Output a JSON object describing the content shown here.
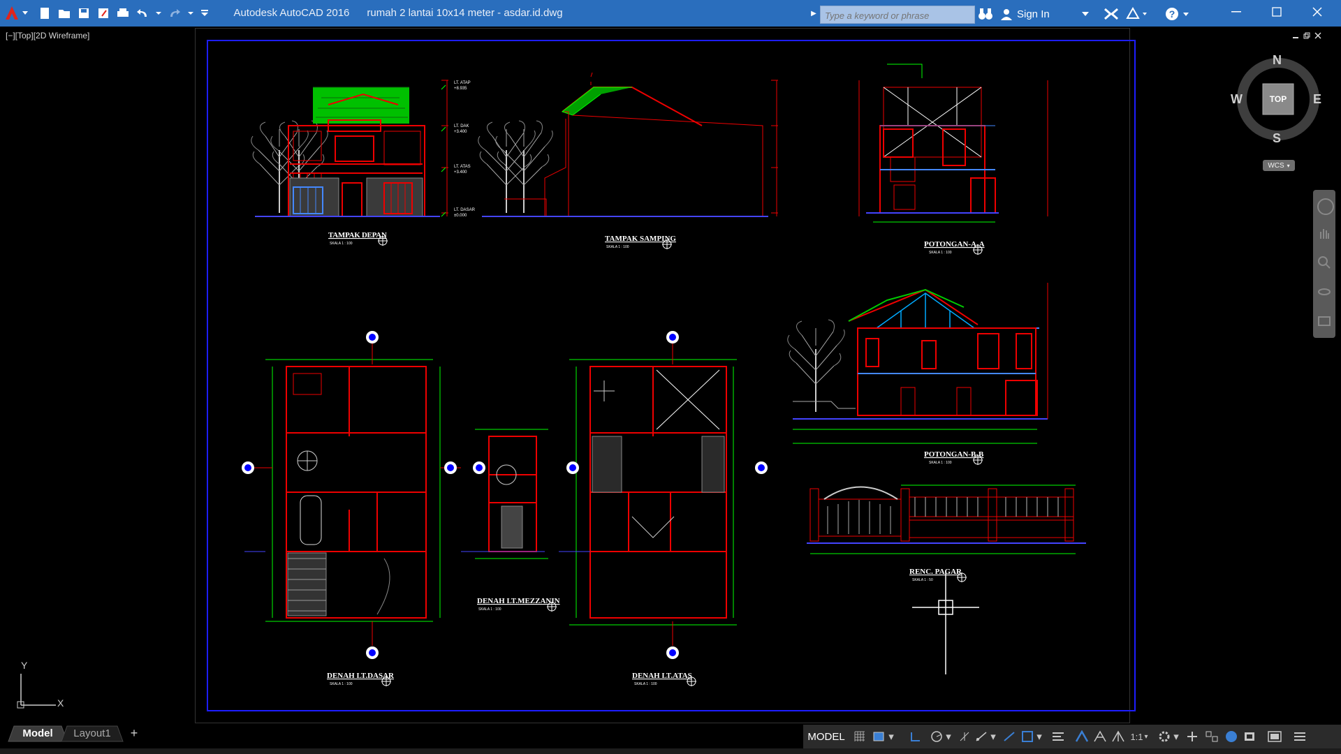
{
  "window": {
    "app_name": "Autodesk AutoCAD 2016",
    "file_name": "rumah 2 lantai 10x14 meter - asdar.id.dwg",
    "brand_color": "#2a6ebd"
  },
  "search": {
    "placeholder": "Type a keyword or phrase"
  },
  "account": {
    "signin_label": "Sign In"
  },
  "viewport": {
    "label": "[−][Top][2D Wireframe]"
  },
  "viewcube": {
    "face": "TOP",
    "north": "N",
    "south": "S",
    "east": "E",
    "west": "W",
    "ucs_label": "WCS"
  },
  "ucs_icon": {
    "x": "X",
    "y": "Y"
  },
  "drawings": {
    "tampak_depan": {
      "title": "TAMPAK DEPAN",
      "scale": "SKALA 1 : 100"
    },
    "tampak_samping": {
      "title": "TAMPAK SAMPING",
      "scale": "SKALA 1 : 100"
    },
    "potongan_aa": {
      "title": "POTONGAN-A-A",
      "scale": "SKALA 1 : 100"
    },
    "potongan_bb": {
      "title": "POTONGAN-B-B",
      "scale": "SKALA 1 : 100"
    },
    "renc_pagar": {
      "title": "RENC. PAGAR",
      "scale": "SKALA 1 : 50"
    },
    "denah_dasar": {
      "title": "DENAH LT.DASAR",
      "scale": "SKALA 1 : 100"
    },
    "denah_mezzanin": {
      "title": "DENAH LT.MEZZANIN",
      "scale": "SKALA 1 : 100"
    },
    "denah_atas": {
      "title": "DENAH LT.ATAS",
      "scale": "SKALA 1 : 100"
    }
  },
  "levels": {
    "atap": "LT. ATAP",
    "atap_val": "+8.935",
    "dak": "LT. DAK",
    "dak_val": "+3.400",
    "atas": "LT. ATAS",
    "atas_val": "+3.400",
    "dasar": "LT. DASAR",
    "dasar_val": "±0.000"
  },
  "tabs": {
    "model": "Model",
    "layout1": "Layout1",
    "add": "+"
  },
  "status": {
    "model_label": "MODEL",
    "scale": "1:1"
  }
}
